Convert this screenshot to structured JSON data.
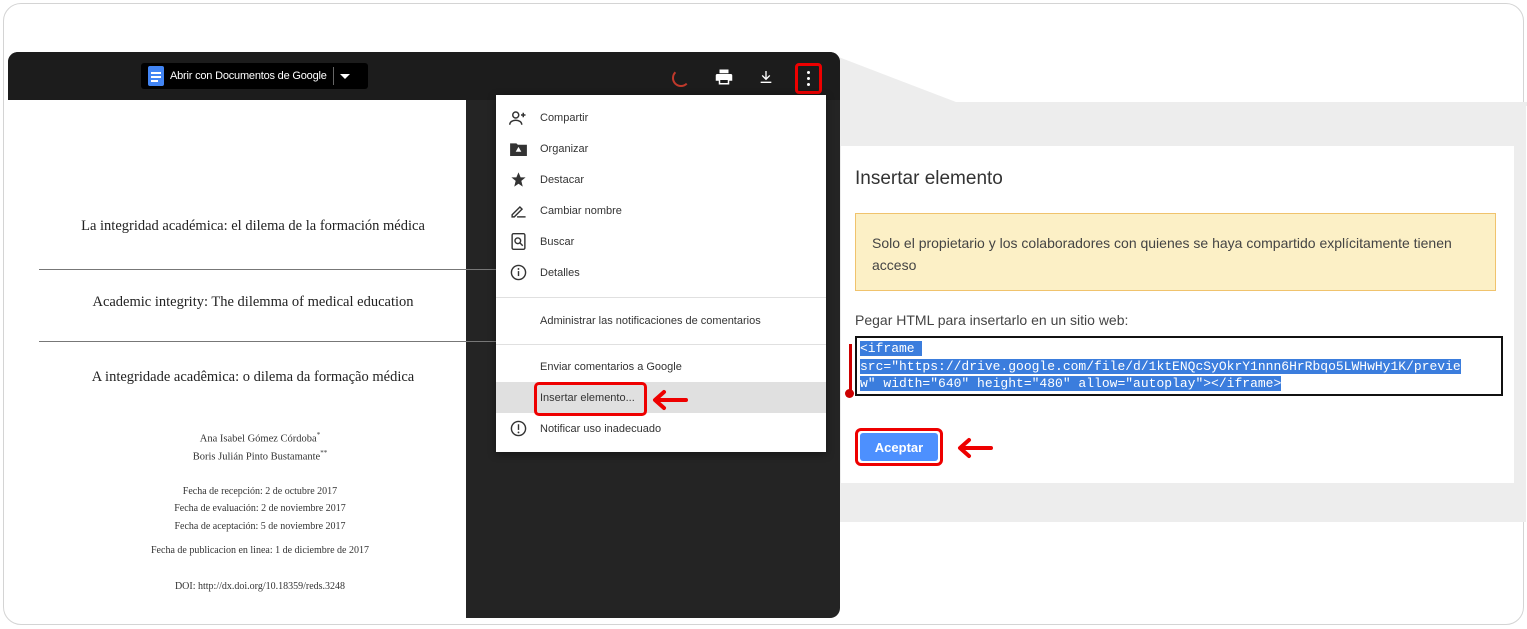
{
  "viewer": {
    "open_with_label": "Abrir con Documentos de Google",
    "icons": [
      "google-docs-icon",
      "caret-down-icon",
      "loading-spinner-icon",
      "print-icon",
      "download-icon",
      "more-vert-icon"
    ]
  },
  "document": {
    "title_es": "La integridad académica: el dilema de la formación médica",
    "title_en": "Academic integrity: The dilemma of medical education",
    "title_pt": "A integridade acadêmica: o dilema da formação médica",
    "author_1": "Ana Isabel Gómez Córdoba",
    "author_1_mark": "*",
    "author_2": "Boris Julián Pinto Bustamante",
    "author_2_mark": "**",
    "date_received": "Fecha de recepción: 2 de octubre 2017",
    "date_evaluated": "Fecha de evaluación: 2 de noviembre 2017",
    "date_accepted": "Fecha de aceptación: 5 de noviembre 2017",
    "date_published": "Fecha de publicacion en linea: 1 de diciembre de 2017",
    "doi": "DOI: http://dx.doi.org/10.18359/reds.3248"
  },
  "menu": {
    "items": [
      {
        "label": "Compartir",
        "icon": "add-person-icon"
      },
      {
        "label": "Organizar",
        "icon": "folder-move-icon"
      },
      {
        "label": "Destacar",
        "icon": "star-icon"
      },
      {
        "label": "Cambiar nombre",
        "icon": "pencil-icon"
      },
      {
        "label": "Buscar",
        "icon": "search-file-icon"
      },
      {
        "label": "Detalles",
        "icon": "info-icon"
      },
      {
        "label": "Administrar las notificaciones de comentarios",
        "icon": ""
      },
      {
        "label": "Enviar comentarios a Google",
        "icon": ""
      },
      {
        "label": "Insertar elemento...",
        "icon": ""
      },
      {
        "label": "Notificar uso inadecuado",
        "icon": "report-icon"
      }
    ],
    "highlighted": "Insertar elemento..."
  },
  "dialog": {
    "title": "Insertar elemento",
    "notice": "Solo el propietario y los colaboradores con quienes se haya compartido explícitamente tienen acceso",
    "paste_label": "Pegar HTML para insertarlo en un sitio web:",
    "code_line_1": "<iframe ",
    "code_line_2": "src=\"https://drive.google.com/file/d/1ktENQcSyOkrY1nnn6HrRbqo5LWHwHy1K/previe",
    "code_line_3": "w\" width=\"640\" height=\"480\" allow=\"autoplay\"></iframe>",
    "accept_label": "Aceptar"
  },
  "colors": {
    "highlight_red": "#ee0000",
    "accept_blue": "#4d90fe",
    "selection_blue": "#3b7ddd",
    "notice_bg": "#fcf0c6"
  }
}
